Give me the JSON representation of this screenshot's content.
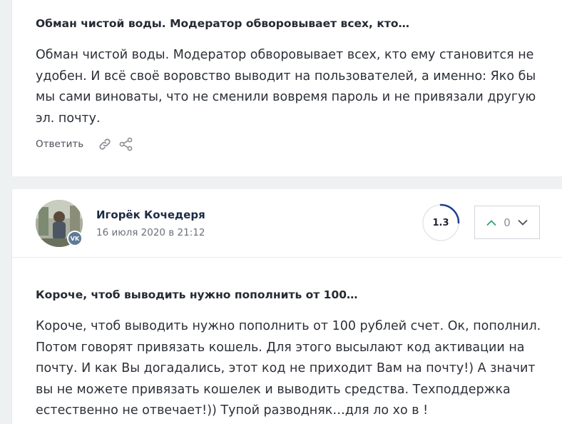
{
  "comments": [
    {
      "title": "Обман чистой воды. Модератор обворовывает всех, кто…",
      "lines": [
        "Обман чистой воды. Модератор обворовывает всех, кто ему становится не",
        "удобен. И всё своё воровство выводит на пользователей, а именно: Яко бы",
        "мы сами виноваты, что не сменили вовремя пароль и не привязали другую",
        "эл. почту."
      ],
      "reply_label": "Ответить",
      "icons": [
        "link-icon",
        "share-icon"
      ]
    },
    {
      "author": "Игорёк Кочедеря",
      "date": "16 июля 2020 в 21:12",
      "avatar_badge": "VK",
      "rating": "1.3",
      "votes": "0",
      "title": "Короче, чтоб выводить нужно пополнить от 100…",
      "lines": [
        "Короче, чтоб выводить нужно пополнить от 100 рублей счет. Ок, пополнил.",
        "Потом говорят привязать кошель. Для этого высылают код активации на",
        "почту. И как Вы догадались, этот код не приходит Вам на почту!) А значит",
        "вы не можете привязать кошелек и выводить средства. Техподдержка",
        "естественно не отвечает!)) Тупой разводняк…для ло хо в !"
      ]
    }
  ],
  "colors": {
    "page_bg": "#eef1f2",
    "card_bg": "#ffffff",
    "vote_up": "#2fa36b",
    "rating_arc": "#1c3f8c"
  }
}
